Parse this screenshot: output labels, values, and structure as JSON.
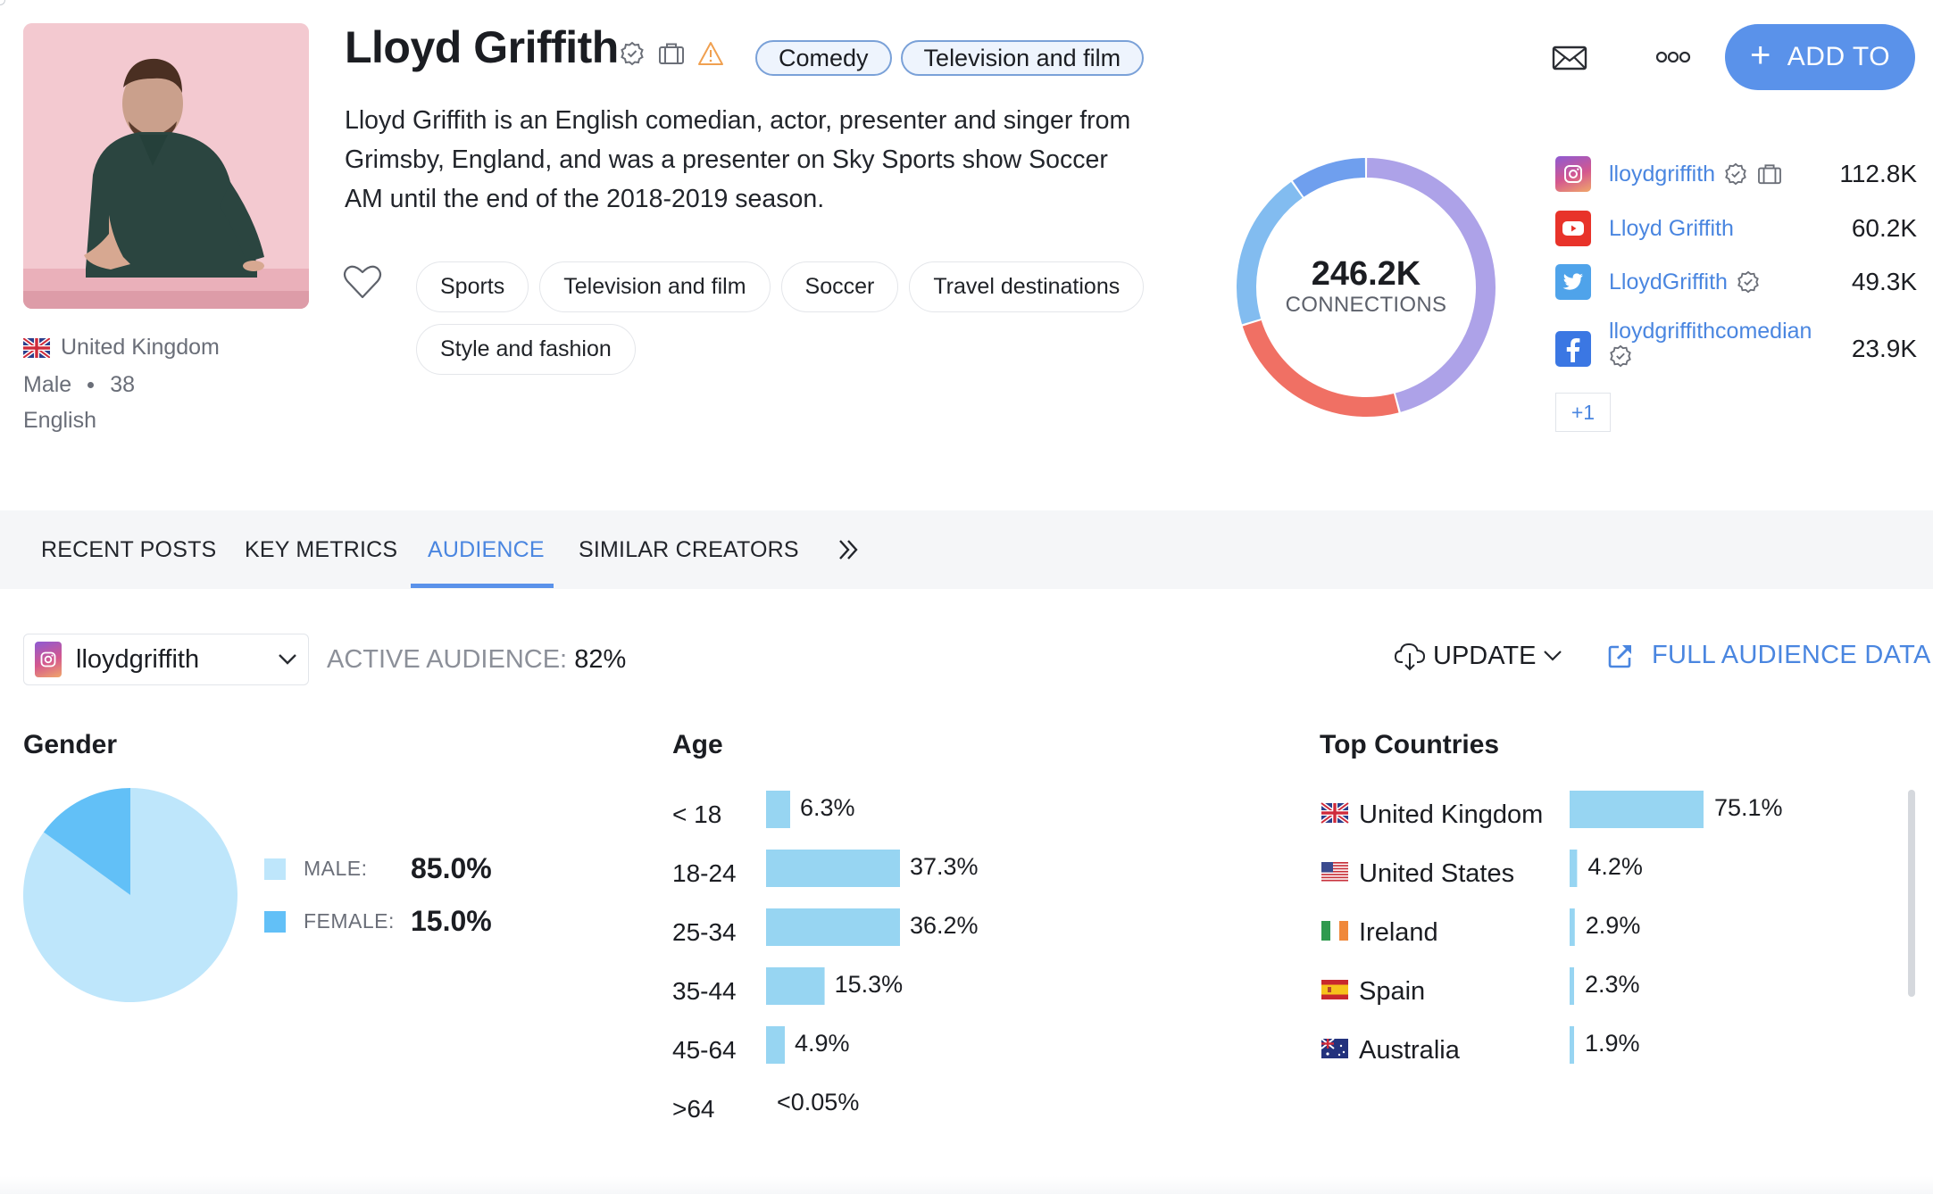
{
  "profile": {
    "name": "Lloyd Griffith",
    "title_icons": [
      "verified-badge-icon",
      "briefcase-icon",
      "warning-icon"
    ],
    "categories": [
      "Comedy",
      "Television and film"
    ],
    "bio": "Lloyd Griffith is an English comedian, actor, presenter and singer from Grimsby, England, and was a presenter on Sky Sports show Soccer AM until the end of the 2018-2019 season.",
    "interests": [
      "Sports",
      "Television and film",
      "Soccer",
      "Travel destinations",
      "Style and fashion"
    ],
    "country": "United Kingdom",
    "gender": "Male",
    "age": "38",
    "language": "English"
  },
  "actions": {
    "add_to_label": "ADD TO",
    "add_to_icon": "plus-icon",
    "mail_icon": "mail-icon",
    "more_icon": "more-dots-icon"
  },
  "connections": {
    "total": "246.2K",
    "label": "CONNECTIONS",
    "more_label": "+1",
    "platforms": [
      {
        "platform": "instagram",
        "handle": "lloydgriffith",
        "verified": true,
        "business": true,
        "count": "112.8K",
        "value": 112.8,
        "color": "#ada2e8"
      },
      {
        "platform": "youtube",
        "handle": "Lloyd Griffith",
        "verified": false,
        "business": false,
        "count": "60.2K",
        "value": 60.2,
        "color": "#f07064"
      },
      {
        "platform": "twitter",
        "handle": "LloydGriffith",
        "verified": true,
        "business": false,
        "count": "49.3K",
        "value": 49.3,
        "color": "#82bcf0"
      },
      {
        "platform": "facebook",
        "handle": "lloydgriffithcomedian",
        "verified": true,
        "business": false,
        "count": "23.9K",
        "value": 23.9,
        "color": "#6f9fee"
      }
    ]
  },
  "tabs": {
    "items": [
      "RECENT POSTS",
      "KEY METRICS",
      "AUDIENCE",
      "SIMILAR CREATORS"
    ],
    "active": "AUDIENCE"
  },
  "audience": {
    "account_select": "lloydgriffith",
    "active_label": "ACTIVE AUDIENCE:",
    "active_value": "82%",
    "update_label": "UPDATE",
    "full_data_label": "FULL AUDIENCE DATA",
    "gender_title": "Gender",
    "age_title": "Age",
    "countries_title": "Top Countries",
    "colors": {
      "male": "#bee6fb",
      "female": "#62c0f7",
      "bar": "#97d5f2",
      "accent": "#4a86e0"
    }
  },
  "chart_data": [
    {
      "type": "pie",
      "title": "Gender",
      "categories": [
        "MALE:",
        "FEMALE:"
      ],
      "values": [
        85.0,
        15.0
      ],
      "labels": [
        "85.0%",
        "15.0%"
      ],
      "legend": "right"
    },
    {
      "type": "bar",
      "orientation": "horizontal",
      "title": "Age",
      "categories": [
        "< 18",
        "18-24",
        "25-34",
        "35-44",
        "45-64",
        ">64"
      ],
      "values": [
        6.3,
        37.3,
        36.2,
        15.3,
        4.9,
        0.05
      ],
      "labels": [
        "6.3%",
        "37.3%",
        "36.2%",
        "15.3%",
        "4.9%",
        "<0.05%"
      ],
      "xlim": [
        0,
        35
      ],
      "grid": false
    },
    {
      "type": "bar",
      "orientation": "horizontal",
      "title": "Top Countries",
      "categories": [
        "United Kingdom",
        "United States",
        "Ireland",
        "Spain",
        "Australia"
      ],
      "values": [
        75.1,
        4.2,
        2.9,
        2.3,
        1.9
      ],
      "labels": [
        "75.1%",
        "4.2%",
        "2.9%",
        "2.3%",
        "1.9%"
      ],
      "flags": [
        "uk-flag-icon",
        "us-flag-icon",
        "ireland-flag-icon",
        "spain-flag-icon",
        "australia-flag-icon"
      ],
      "xlim": [
        0,
        75.1
      ],
      "grid": false
    },
    {
      "type": "pie",
      "subtype": "donut",
      "title": "Connections",
      "categories": [
        "Instagram",
        "YouTube",
        "Twitter",
        "Facebook"
      ],
      "values": [
        112.8,
        60.2,
        49.3,
        23.9
      ],
      "center_label": "246.2K CONNECTIONS"
    }
  ]
}
